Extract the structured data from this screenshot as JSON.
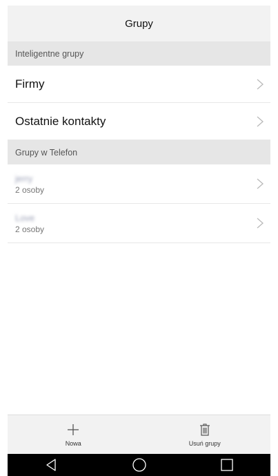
{
  "header": {
    "title": "Grupy"
  },
  "smart_groups": {
    "section_title": "Inteligentne grupy",
    "items": [
      {
        "label": "Firmy"
      },
      {
        "label": "Ostatnie kontakty"
      }
    ]
  },
  "phone_groups": {
    "section_title": "Grupy w Telefon",
    "items": [
      {
        "name": "jerry",
        "count": "2 osoby"
      },
      {
        "name": "Love",
        "count": "2 osoby"
      }
    ]
  },
  "toolbar": {
    "new_label": "Nowa",
    "delete_label": "Usuń grupy"
  },
  "icons": {
    "chevron": "chevron-right-icon",
    "new": "plus-icon",
    "delete": "trash-icon",
    "nav_back": "back-triangle-icon",
    "nav_home": "home-circle-icon",
    "nav_recents": "recents-square-icon"
  },
  "colors": {
    "header_bg": "#f2f2f2",
    "section_bg": "#e6e6e6",
    "navbar_bg": "#000000"
  }
}
